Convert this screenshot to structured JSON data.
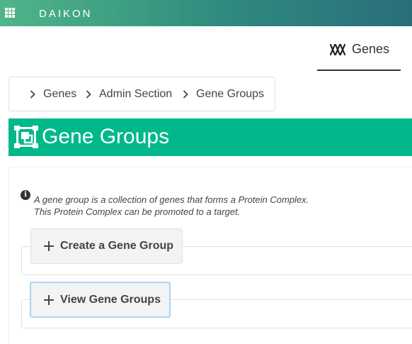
{
  "topbar": {
    "brand": "DAIKON",
    "menu_icon": "apps-grid-icon"
  },
  "tabs": [
    {
      "label": "Genes",
      "icon": "dna-icon",
      "active": true
    }
  ],
  "breadcrumb": {
    "items": [
      "Genes",
      "Admin Section",
      "Gene Groups"
    ]
  },
  "page": {
    "title": "Gene Groups",
    "title_icon": "group-objects-icon",
    "accent": "#00b88a"
  },
  "info": {
    "icon": "info-icon",
    "line1": "A gene group is a collection of genes that forms a Protein Complex.",
    "line2": "This Protein Complex can be promoted to a target."
  },
  "actions": {
    "create": {
      "label": "Create a Gene Group",
      "icon": "plus-icon"
    },
    "view": {
      "label": "View Gene Groups",
      "icon": "plus-icon"
    }
  }
}
